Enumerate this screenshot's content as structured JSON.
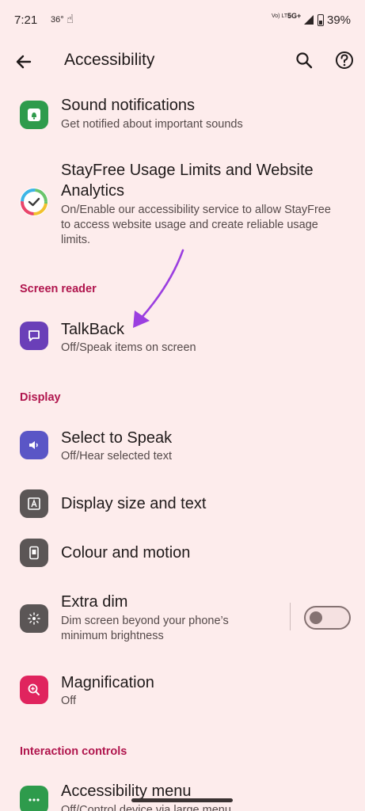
{
  "status_bar": {
    "time": "7:21",
    "temp": "36°",
    "volte": "Vo) LTE",
    "network": "5G+",
    "battery": "39%"
  },
  "app_bar": {
    "title": "Accessibility"
  },
  "items": {
    "sound_notifications": {
      "title": "Sound notifications",
      "subtitle": "Get notified about important sounds"
    },
    "stayfree": {
      "title_line1": "StayFree Usage Limits and Website",
      "title_line2": "Analytics",
      "subtitle_line1": "On/Enable our accessibility service to allow StayFree",
      "subtitle_line2": "to access website usage and create reliable usage",
      "subtitle_line3": "limits."
    },
    "talkback": {
      "title": "TalkBack",
      "subtitle": "Off/Speak items on screen"
    },
    "select_to_speak": {
      "title": "Select to Speak",
      "subtitle": "Off/Hear selected text"
    },
    "display_size": {
      "title": "Display size and text"
    },
    "colour_motion": {
      "title": "Colour and motion"
    },
    "extra_dim": {
      "title": "Extra dim",
      "subtitle_line1": "Dim screen beyond your phone’s",
      "subtitle_line2": "minimum brightness",
      "enabled": false
    },
    "magnification": {
      "title": "Magnification",
      "subtitle": "Off"
    },
    "accessibility_menu": {
      "title": "Accessibility menu",
      "subtitle": "Off/Control device via large menu"
    }
  },
  "sections": {
    "screen_reader": "Screen reader",
    "display": "Display",
    "interaction_controls": "Interaction controls"
  },
  "colors": {
    "background": "#fdecec",
    "accent": "#b0154d",
    "annotation_arrow": "#9b3fe0"
  }
}
